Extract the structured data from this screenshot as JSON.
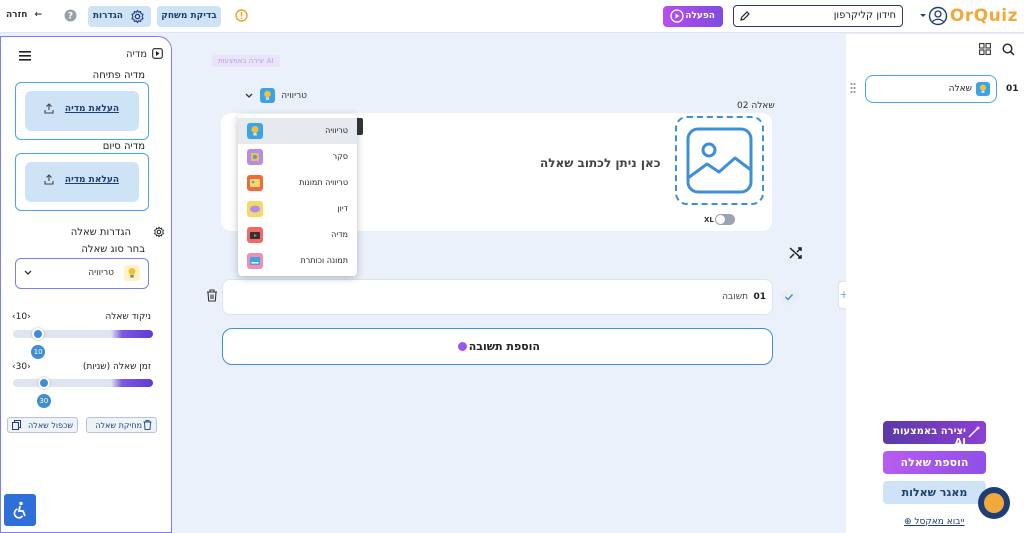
{
  "header": {
    "logo": "OrQuiz",
    "title_value": "חידון קליקרפון",
    "activate_label": "הפעלה",
    "test_game_label": "בדיקת משחק",
    "settings_label": "הגדרות",
    "back_label": "חזרה"
  },
  "left_panel": {
    "media_title": "מדיה",
    "opening_media_label": "מדיה פתיחה",
    "upload_media_label": "העלאת מדיה",
    "closing_media_label": "מדיה סיום",
    "upload_media_label_2": "העלאת מדיה",
    "question_settings_title": "הגדרות שאלה",
    "choose_type_label": "בחר סוג שאלה",
    "selected_type": "טריוויה",
    "score_label": "ניקוד שאלה",
    "score_value": "10",
    "score_badge": "10",
    "score_fraction": 0.82,
    "time_label": "זמן שאלה (שניות)",
    "time_value": "30",
    "time_badge": "30",
    "time_fraction": 0.78,
    "duplicate_label": "שכפול שאלה",
    "delete_label": "מחיקת שאלה"
  },
  "center": {
    "ai_tag": "יצירה באמצעות AI",
    "type_selector_label": "טריוויה",
    "question_number_label": "שאלה 02",
    "question_placeholder": "כאן ניתן לכתוב שאלה",
    "xl_label": "XL",
    "answer_number": "01",
    "answer_placeholder": "תשובה",
    "add_answer_label": "הוספת תשובה"
  },
  "dropdown": {
    "items": [
      {
        "label": "טריוויה",
        "icon": "bulb-icon",
        "color": "#3ba3e8",
        "selected": true
      },
      {
        "label": "סקר",
        "icon": "survey-icon",
        "color": "#b18cf2",
        "selected": false
      },
      {
        "label": "טריוויה תמונות",
        "icon": "picture-trivia-icon",
        "color": "#f06a3e",
        "selected": false
      },
      {
        "label": "דיון",
        "icon": "discussion-icon",
        "color": "#f6d86a",
        "selected": false
      },
      {
        "label": "מדיה",
        "icon": "media-icon",
        "color": "#f06a6a",
        "selected": false
      },
      {
        "label": "תמונה וכותרת",
        "icon": "image-title-icon",
        "color": "#f08fb0",
        "selected": false
      }
    ]
  },
  "right_panel": {
    "question_number": "01",
    "question_label": "שאלה",
    "ai_create_label": "יצירה באמצעות AI",
    "add_question_label": "הוספת שאלה",
    "question_bank_label": "מאגר שאלות",
    "import_excel_label": "ייבוא מאקסל"
  },
  "colors": {
    "primary": "#1f3f74",
    "accent": "#7c4ce0",
    "light_blue": "#cfe3f7",
    "background": "#ebf1fb"
  }
}
